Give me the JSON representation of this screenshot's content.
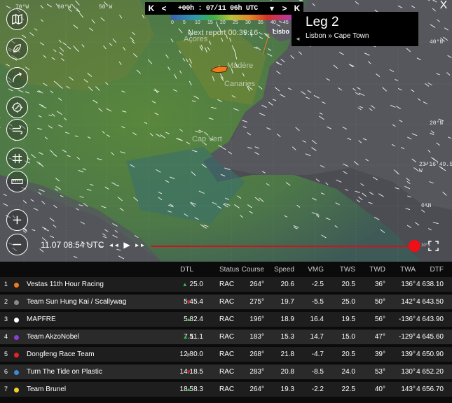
{
  "map": {
    "lat_labels": [
      "70°W",
      "60°W",
      "50°W",
      "40°N",
      "20°N",
      "0°N"
    ],
    "places": [
      "Açores",
      "Madère",
      "Canaries",
      "Cap Vert"
    ],
    "coordinate_readout": "23°16'49.5 W",
    "next_report": "Next report 00:39:16",
    "lisbon_tag": "Lisbo",
    "timebar": {
      "first_label": "K",
      "prev_label": "<",
      "time": "+00h : 07/11 06h UTC",
      "dropdown_label": "▾",
      "next_label": ">",
      "last_label": "K"
    },
    "wind_scale": [
      "0",
      "5",
      "10",
      "15",
      "20",
      "25",
      "30",
      "35",
      "40",
      "45"
    ],
    "close_label": "X",
    "leg": {
      "title": "Leg 2",
      "route": "Lisbon » Cape Town",
      "arrow": "◄"
    },
    "controls": [
      "map-icon",
      "feathers-icon",
      "route-icon",
      "compass-icon",
      "wind-icon",
      "grid-icon",
      "ruler-icon",
      "zoom-in-icon",
      "zoom-out-icon"
    ],
    "playback": {
      "datetime": "11.07 08:54 UTC",
      "rewind": "◄◄",
      "play": "▶",
      "forward": "►►",
      "scale_mark": "10°S"
    }
  },
  "table": {
    "headers": {
      "dtl": "DTL",
      "status": "Status",
      "course": "Course",
      "speed": "Speed",
      "vmg": "VMG",
      "tws": "TWS",
      "twd": "TWD",
      "twa": "TWA",
      "dtf": "DTF"
    },
    "rows": [
      {
        "rank": "1",
        "color": "#f07a1e",
        "name": "Vestas 11th Hour Racing",
        "dtl": "",
        "trend": "up",
        "change": "25.0",
        "status": "RAC",
        "course": "264°",
        "speed": "20.6",
        "vmg": "-2.5",
        "tws": "20.5",
        "twd": "36°",
        "twa": "136°",
        "dtf": "4 638.10"
      },
      {
        "rank": "2",
        "color": "#8a8a8a",
        "name": "Team Sun Hung Kai / Scallywag",
        "dtl": "5.4",
        "trend": "down",
        "change": "5.4",
        "status": "RAC",
        "course": "275°",
        "speed": "19.7",
        "vmg": "-5.5",
        "tws": "25.0",
        "twd": "50°",
        "twa": "142°",
        "dtf": "4 643.50"
      },
      {
        "rank": "3",
        "color": "#ffffff",
        "name": "MAPFRE",
        "dtl": "5.8",
        "trend": "up",
        "change": "2.4",
        "status": "RAC",
        "course": "196°",
        "speed": "18.9",
        "vmg": "16.4",
        "tws": "19.5",
        "twd": "56°",
        "twa": "-136°",
        "dtf": "4 643.90"
      },
      {
        "rank": "4",
        "color": "#8e3cd4",
        "name": "Team AkzoNobel",
        "dtl": "7.5",
        "trend": "up",
        "change": "11.1",
        "status": "RAC",
        "course": "183°",
        "speed": "15.3",
        "vmg": "14.7",
        "tws": "15.0",
        "twd": "47°",
        "twa": "-129°",
        "dtf": "4 645.60"
      },
      {
        "rank": "5",
        "color": "#e2232a",
        "name": "Dongfeng Race Team",
        "dtl": "12.8",
        "trend": "flat",
        "change": "0.0",
        "status": "RAC",
        "course": "268°",
        "speed": "21.8",
        "vmg": "-4.7",
        "tws": "20.5",
        "twd": "39°",
        "twa": "139°",
        "dtf": "4 650.90"
      },
      {
        "rank": "6",
        "color": "#3a8ad8",
        "name": "Turn The Tide on Plastic",
        "dtl": "14.1",
        "trend": "down",
        "change": "8.5",
        "status": "RAC",
        "course": "283°",
        "speed": "20.8",
        "vmg": "-8.5",
        "tws": "24.0",
        "twd": "53°",
        "twa": "130°",
        "dtf": "4 652.20"
      },
      {
        "rank": "7",
        "color": "#f4d02a",
        "name": "Team Brunel",
        "dtl": "18.5",
        "trend": "up",
        "change": "8.3",
        "status": "RAC",
        "course": "264°",
        "speed": "19.3",
        "vmg": "-2.2",
        "tws": "22.5",
        "twd": "40°",
        "twa": "143°",
        "dtf": "4 656.70"
      }
    ]
  },
  "colors": {
    "accent_red": "#ef0f15",
    "up": "#36c04a",
    "down": "#e2232a"
  }
}
